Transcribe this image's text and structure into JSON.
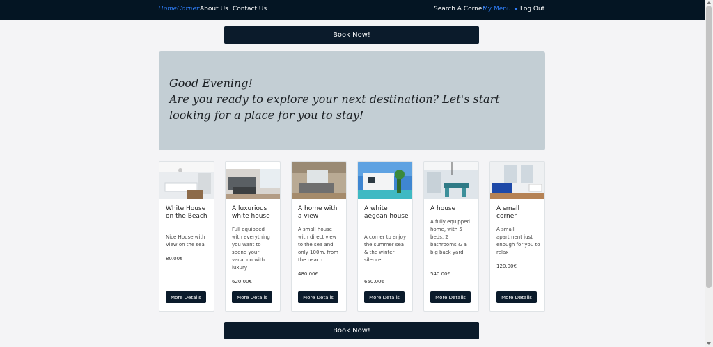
{
  "nav": {
    "brand": "HomeCorner",
    "about": "About Us",
    "contact": "Contact Us",
    "search": "Search A Corner",
    "my_menu": "My Menu",
    "logout": "Log Out"
  },
  "actions": {
    "book_now_top": "Book Now!",
    "book_now_bottom": "Book Now!"
  },
  "greeting": {
    "line1": "Good Evening!",
    "line2": "Are you ready to explore your next destination? Let's start looking for a place for you to stay!"
  },
  "cards": [
    {
      "title": "White House on the Beach",
      "description": "Nice House with View on the sea",
      "price": "80.00€",
      "button": "More Details"
    },
    {
      "title": "A luxurious white house",
      "description": "Full equipped with everything you want to spend your vacation with luxury",
      "price": "620.00€",
      "button": "More Details"
    },
    {
      "title": "A home with a view",
      "description": "A small house with direct view to the sea and only 100m. from the beach",
      "price": "480.00€",
      "button": "More Details"
    },
    {
      "title": "A white aegean house",
      "description": "A corner to enjoy the summer sea & the winter silence",
      "price": "650.00€",
      "button": "More Details"
    },
    {
      "title": "A house",
      "description": "A fully equipped home, with 5 beds, 2 bathrooms & a big back yard",
      "price": "540.00€",
      "button": "More Details"
    },
    {
      "title": "A small corner",
      "description": "A small apartment just enough for you to relax",
      "price": "120.00€",
      "button": "More Details"
    }
  ],
  "colors": {
    "nav_bg": "#041523",
    "accent": "#2f7df6",
    "button_bg": "#0b1b2b",
    "greeting_bg": "#c3ced4"
  }
}
